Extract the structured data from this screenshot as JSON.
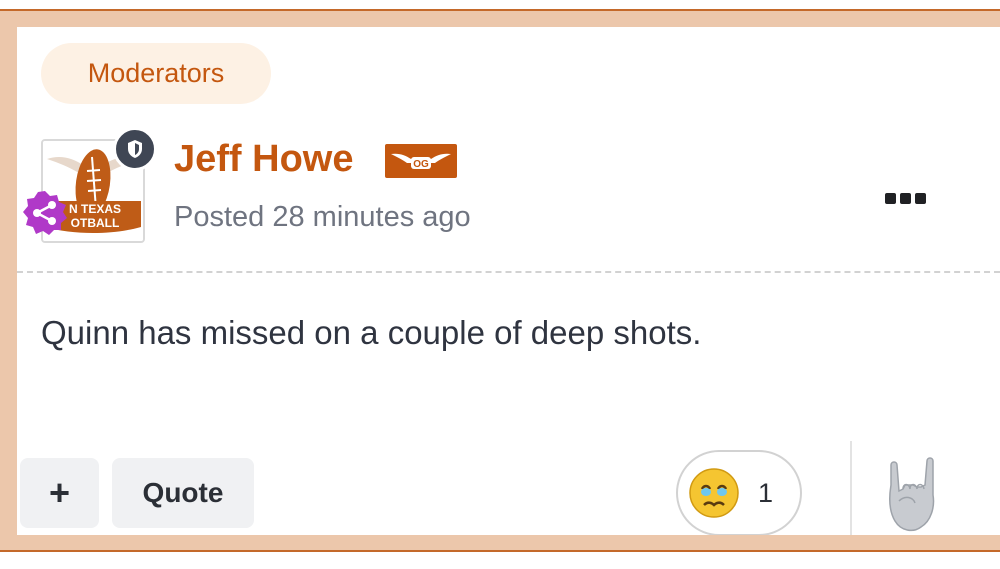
{
  "group_badge": "Moderators",
  "author": {
    "name": "Jeff Howe",
    "badge_text": "OG",
    "avatar_text_line1": "N TEXAS",
    "avatar_text_line2": "OTBALL"
  },
  "post": {
    "timestamp": "Posted 28 minutes ago",
    "body": "Quinn has missed on a couple of deep shots."
  },
  "actions": {
    "plus_label": "+",
    "quote_label": "Quote"
  },
  "reaction": {
    "icon": "crying-face-icon",
    "count": "1"
  },
  "react_button_icon": "rock-on-hand-icon",
  "colors": {
    "accent": "#c4570f",
    "frame": "#ecc7ab",
    "frame_border": "#c4692a",
    "share_badge": "#b039c8"
  }
}
